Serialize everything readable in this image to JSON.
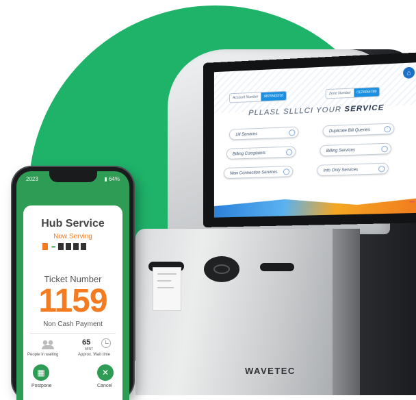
{
  "colors": {
    "background_circle": "#1fb36a",
    "accent_orange": "#f47b20",
    "phone_green": "#2e9c55",
    "kiosk_screen_blue": "#1b8fe0"
  },
  "kiosk": {
    "screen": {
      "home_icon": "home-icon",
      "id_left": {
        "label": "Account Number",
        "value": "9876543210"
      },
      "id_right": {
        "label": "Zone Number",
        "value": "0123456789"
      },
      "title_prefix": "PLLASL SLLLCI YOUR",
      "title_emphasis": "SERVICE",
      "services": [
        "1ill Services",
        "Duplicate Bill Queries",
        "Billing Complaints",
        "Billing Services",
        "New Connection Services",
        "Info Only Services"
      ]
    },
    "brand": "WAVETEC"
  },
  "phone": {
    "status": {
      "time": "2023",
      "battery": "64%"
    },
    "app": {
      "title": "Hub Service",
      "subtitle": "Now Serving",
      "ticket_label": "Ticket Number",
      "ticket_number": "1159",
      "payment_type": "Non Cash Payment",
      "people_waiting_label": "People in waiting",
      "wait_value": "65",
      "wait_unit": "MINT",
      "wait_label": "Approx. Wait time",
      "postpone_label": "Postpone",
      "cancel_label": "Cancel"
    }
  }
}
